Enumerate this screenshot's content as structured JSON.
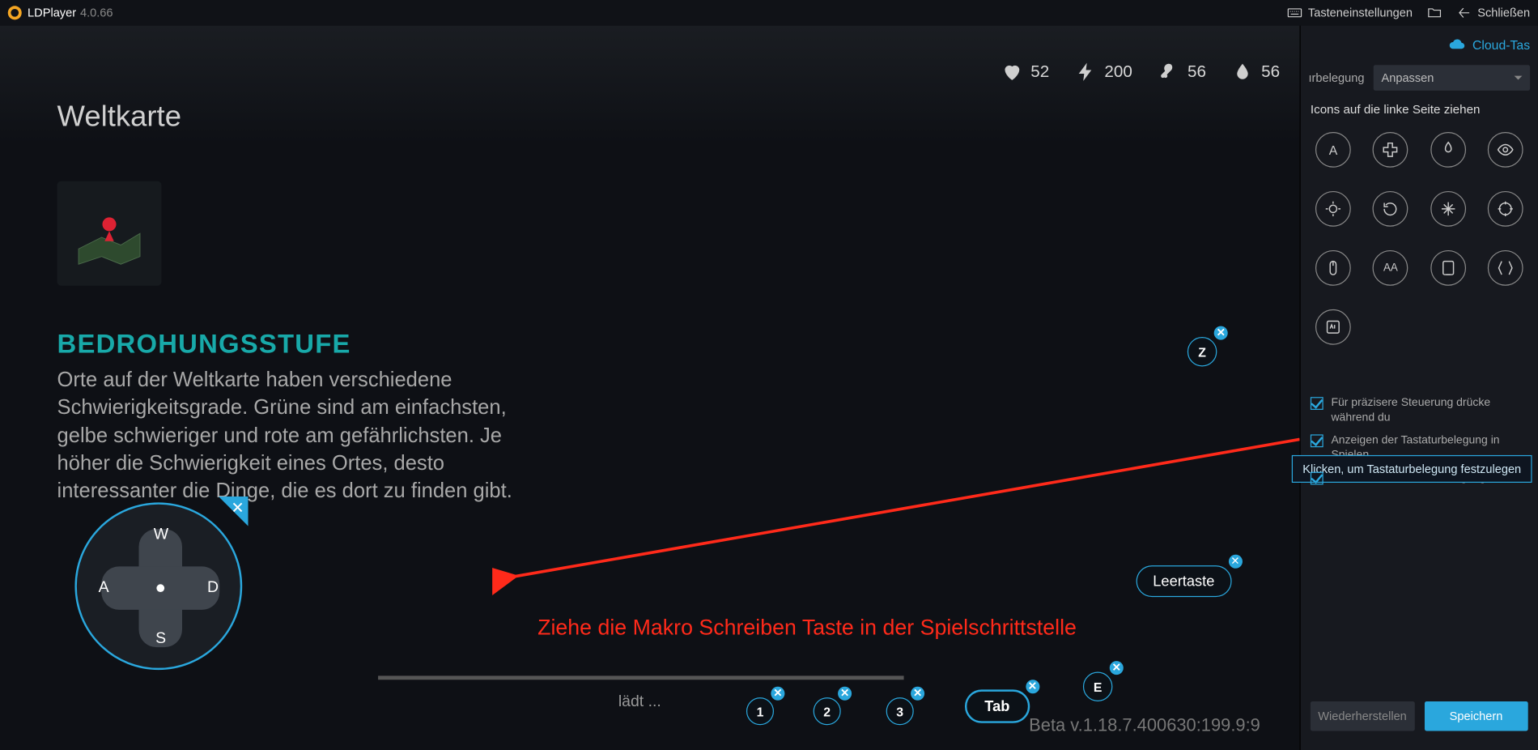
{
  "titlebar": {
    "app": "LDPlayer",
    "version": "4.0.66",
    "keymap": "Tasteneinstellungen",
    "close": "Schließen"
  },
  "stats": {
    "health": "52",
    "energy": "200",
    "meat": "56",
    "water": "56"
  },
  "map_title": "Weltkarte",
  "threat": {
    "title": "BEDROHUNGSSTUFE",
    "body": "Orte auf der Weltkarte haben verschiedene Schwierigkeitsgrade. Grüne sind am einfachsten, gelbe schwieriger und rote am gefährlichsten. Je höher die Schwierigkeit eines Ortes, desto interessanter die Dinge, die es dort zu finden gibt."
  },
  "dpad": {
    "up": "W",
    "down": "S",
    "left": "A",
    "right": "D"
  },
  "keys": {
    "z": "Z",
    "space": "Leertaste",
    "tab": "Tab",
    "e": "E",
    "n1": "1",
    "n2": "2",
    "n3": "3"
  },
  "loading_text": "lädt ...",
  "beta": "Beta v.1.18.7.400630:199.9:9",
  "annotation": "Ziehe die Makro Schreiben Taste in der Spielschrittstelle",
  "side": {
    "cloud": "Cloud-Tas",
    "belegung_label": "ırbelegung",
    "belegung_value": "Anpassen",
    "drag_hint": "Icons auf die linke Seite ziehen",
    "tooltip": "Klicken, um Tastaturbelegung festzulegen",
    "chk1": "Für präzisere Steuerung drücke während du",
    "chk2": "Anzeigen der Tastaturbelegung in Spielen",
    "chk3": "Hinweise zur Tastaturbelegung beim",
    "restore": "Wiederherstellen",
    "save": "Speichern"
  }
}
